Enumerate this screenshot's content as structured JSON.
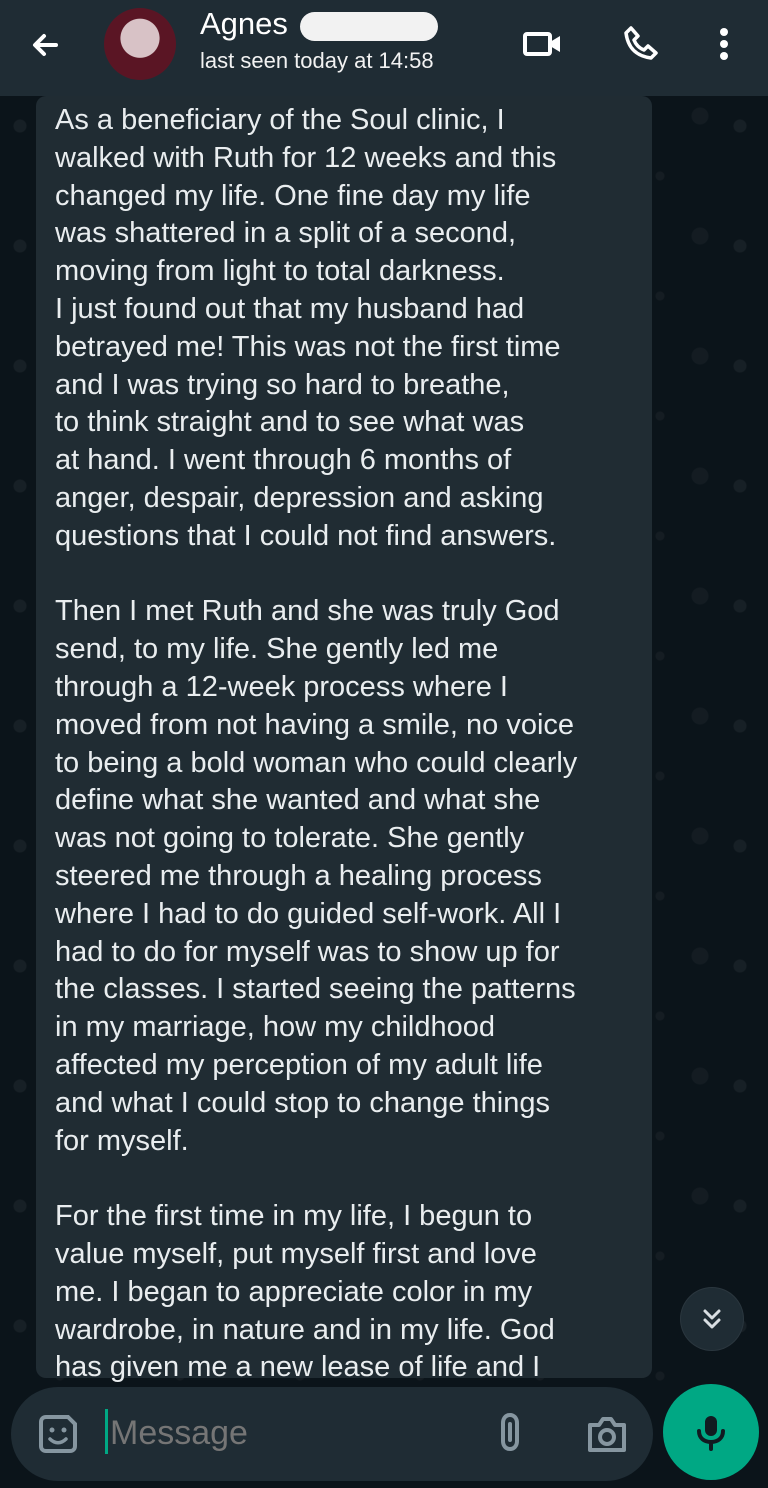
{
  "header": {
    "contact_name": "Agnes",
    "status": "last seen today at 14:58"
  },
  "message": {
    "text": "As a beneficiary of the Soul clinic, I\nwalked with Ruth for 12 weeks and this\nchanged my life. One fine day my life\nwas shattered in a split of a second,\nmoving from light to total darkness.\nI just found out that my husband had\nbetrayed me! This was not the first time\nand I was trying so hard to breathe,\nto think straight and to see what was\nat hand. I went through 6 months of\nanger, despair, depression and asking\nquestions that I could not find answers.\n\nThen I met Ruth and she was truly God\nsend, to my life. She gently led me\nthrough a 12-week process where I\nmoved from not having a smile, no voice\nto being a bold woman who could clearly\ndefine what she wanted and what she\nwas not going to tolerate. She gently\nsteered me through a healing process\nwhere I had to do guided self-work. All I\nhad to do for myself was to show up for\nthe classes. I started seeing the patterns\nin my marriage, how my childhood\naffected my perception of my adult life\nand what I could stop to change things\nfor myself.\n\nFor the first time in my life, I begun to\nvalue myself, put myself first and love\nme. I began to appreciate color in my\nwardrobe, in nature and in my life. God\nhas given me a new lease of life and I"
  },
  "composer": {
    "placeholder": "Message"
  },
  "icons": {
    "back": "arrow-left-icon",
    "video": "video-call-icon",
    "call": "phone-icon",
    "menu": "more-vert-icon",
    "emoji": "emoji-icon",
    "attach": "paperclip-icon",
    "camera": "camera-icon",
    "mic": "microphone-icon",
    "scroll": "double-chevron-down-icon"
  },
  "colors": {
    "accent": "#00a884",
    "bubble": "#202c33",
    "header": "#1f2c34",
    "background": "#0b141a"
  }
}
